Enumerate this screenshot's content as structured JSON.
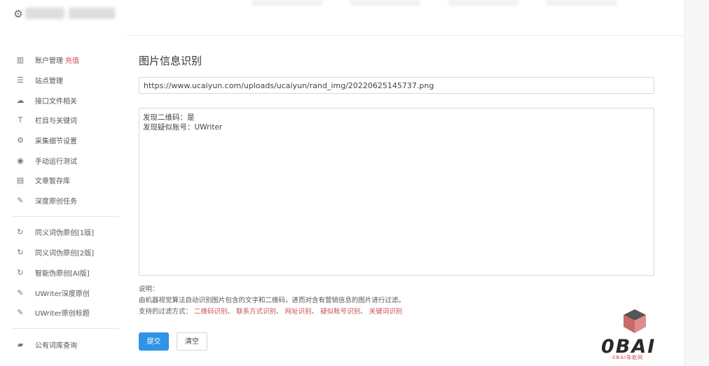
{
  "header": {
    "gear_icon": "gear-icon"
  },
  "sidebar": {
    "items": [
      {
        "label": "账户管理",
        "badge": "充值",
        "icon": "bar-chart-icon"
      },
      {
        "label": "站点管理",
        "icon": "list-icon"
      },
      {
        "label": "接口文件相关",
        "icon": "cloud-icon"
      },
      {
        "label": "栏目与关键词",
        "icon": "filter-icon"
      },
      {
        "label": "采集细节设置",
        "icon": "gears-icon"
      },
      {
        "label": "手动运行测试",
        "icon": "play-icon"
      },
      {
        "label": "文章暂存库",
        "icon": "trash-icon"
      },
      {
        "label": "深度原创任务",
        "icon": "edit-icon"
      },
      {
        "label": "同义词伪原创[1版]",
        "icon": "refresh-icon"
      },
      {
        "label": "同义词伪原创[2版]",
        "icon": "refresh-icon"
      },
      {
        "label": "智能伪原创[AI版]",
        "icon": "refresh-icon"
      },
      {
        "label": "UWriter深度原创",
        "icon": "edit-icon"
      },
      {
        "label": "UWriter原创标题",
        "icon": "edit-icon"
      },
      {
        "label": "公有词库查询",
        "icon": "book-icon"
      }
    ]
  },
  "main": {
    "title": "图片信息识别",
    "url_value": "https://www.ucaiyun.com/uploads/ucaiyun/rand_img/20220625145737.png",
    "result_lines": [
      "发现二维码：是",
      "发现疑似账号：UWriter"
    ],
    "notes": {
      "heading": "说明：",
      "line1": "由机器视觉算法自动识别图片包含的文字和二维码，进而对含有营销信息的图片进行过滤。",
      "line2_prefix": "支持的过滤方式：",
      "methods": [
        "二维码识别",
        "联系方式识别",
        "网址识别",
        "疑似账号识别",
        "关键词识别"
      ],
      "separator": "、"
    },
    "submit_label": "提交",
    "clear_label": "清空"
  },
  "watermark": {
    "logo_text": "0BAI",
    "logo_sub": "0BAI导航网"
  }
}
